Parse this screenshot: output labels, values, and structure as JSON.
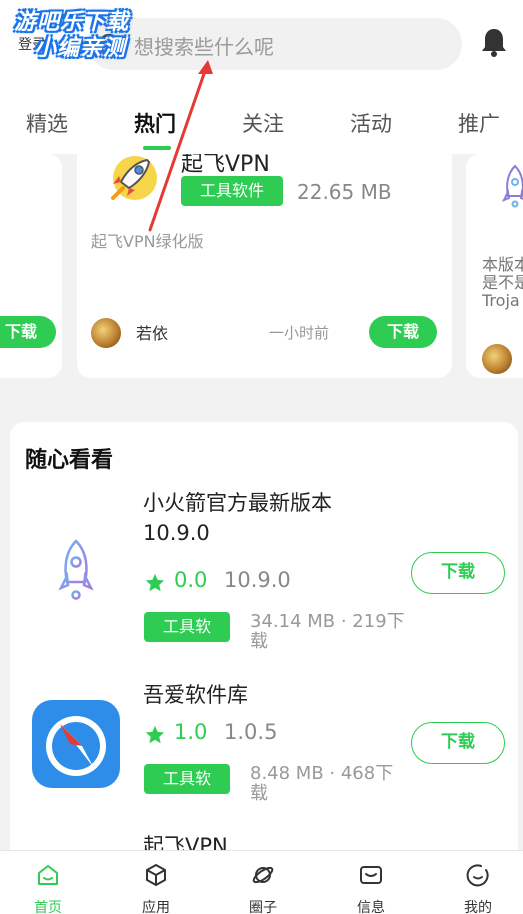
{
  "watermark": {
    "line1": "游吧乐下载",
    "line2": "小编亲测"
  },
  "header": {
    "login_label": "登录",
    "search_placeholder": "想搜索些什么呢"
  },
  "tabs": [
    "精选",
    "热门",
    "关注",
    "活动",
    "推广"
  ],
  "active_tab": "热门",
  "carousel": {
    "left": {
      "download_label": "下载"
    },
    "main": {
      "name": "起飞VPN",
      "tag": "工具软件",
      "size": "22.65 MB",
      "description": "起飞VPN绿化版",
      "user": "若依",
      "time": "一小时前",
      "download_label": "下载"
    },
    "right": {
      "desc_lines": [
        "本版本",
        "是不是",
        "Troja"
      ]
    }
  },
  "section": {
    "title": "随心看看",
    "items": [
      {
        "name": "小火箭官方最新版本10.9.0",
        "rating": "0.0",
        "version": "10.9.0",
        "tag": "工具软",
        "meta": "34.14 MB · 219下载",
        "download_label": "下载",
        "icon": "rocket-icon"
      },
      {
        "name": "吾爱软件库",
        "rating": "1.0",
        "version": "1.0.5",
        "tag": "工具软",
        "meta": "8.48 MB · 468下载",
        "download_label": "下载",
        "icon": "compass-icon"
      }
    ],
    "peek_name": "起飞VPN"
  },
  "bottom_nav": [
    {
      "label": "首页",
      "icon": "home-icon",
      "active": true
    },
    {
      "label": "应用",
      "icon": "box-icon",
      "active": false
    },
    {
      "label": "圈子",
      "icon": "planet-icon",
      "active": false
    },
    {
      "label": "信息",
      "icon": "message-icon",
      "active": false
    },
    {
      "label": "我的",
      "icon": "profile-icon",
      "active": false
    }
  ],
  "colors": {
    "accent": "#2ecc52",
    "annotation_arrow": "#e53935",
    "watermark": "#1a73e8"
  }
}
